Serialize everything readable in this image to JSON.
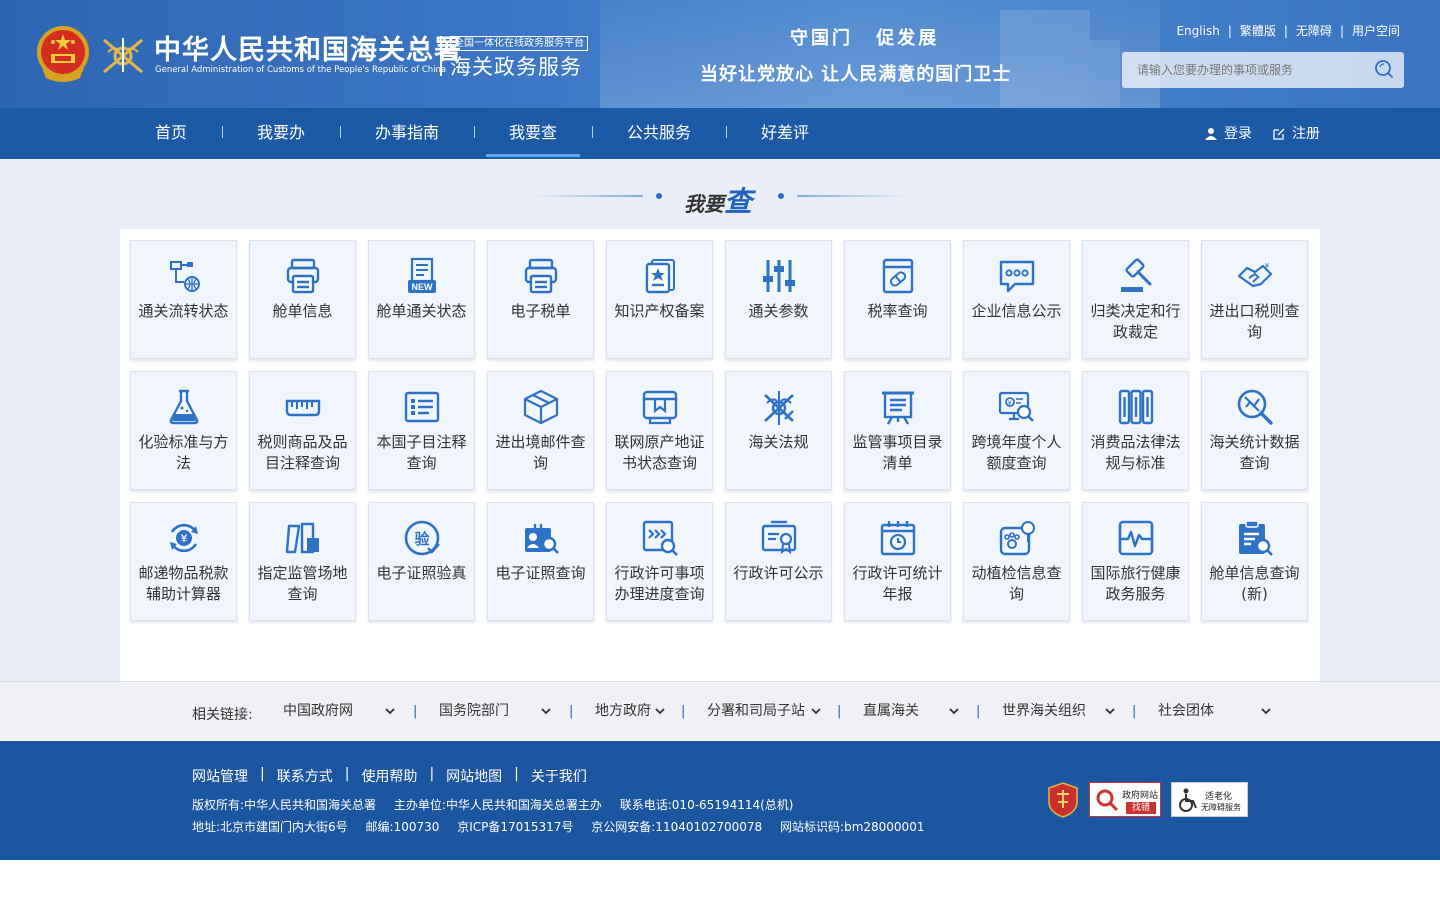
{
  "header": {
    "title_cn": "中华人民共和国海关总署",
    "title_en": "General Administration of Customs of the People's Republic of China",
    "platform_tag": "全国一体化在线政务服务平台",
    "platform_name": "海关政务服务",
    "slogan_line1": "守国门  促发展",
    "slogan_line2": "当好让党放心  让人民满意的国门卫士",
    "top_links": [
      "English",
      "繁體版",
      "无障碍",
      "用户空间"
    ],
    "search_placeholder": "请输入您要办理的事项或服务"
  },
  "nav": {
    "items": [
      "首页",
      "我要办",
      "办事指南",
      "我要查",
      "公共服务",
      "好差评"
    ],
    "active_index": 3,
    "login": "登录",
    "register": "注册"
  },
  "section": {
    "title_prefix": "我要",
    "title_main": "查"
  },
  "services": [
    {
      "label": "通关流转状态",
      "icon": "flow-network-icon"
    },
    {
      "label": "舱单信息",
      "icon": "printer-icon"
    },
    {
      "label": "舱单通关状态",
      "icon": "new-document-icon"
    },
    {
      "label": "电子税单",
      "icon": "printer-icon"
    },
    {
      "label": "知识产权备案",
      "icon": "star-certificate-icon"
    },
    {
      "label": "通关参数",
      "icon": "sliders-icon"
    },
    {
      "label": "税率查询",
      "icon": "rate-document-icon"
    },
    {
      "label": "企业信息公示",
      "icon": "chat-bubble-icon"
    },
    {
      "label": "归类决定和行政裁定",
      "icon": "gavel-icon"
    },
    {
      "label": "进出口税则查询",
      "icon": "handshake-icon"
    },
    {
      "label": "化验标准与方法",
      "icon": "flask-icon"
    },
    {
      "label": "税则商品及品目注释查询",
      "icon": "ruler-icon"
    },
    {
      "label": "本国子目注释查询",
      "icon": "list-icon"
    },
    {
      "label": "进出境邮件查询",
      "icon": "box-icon"
    },
    {
      "label": "联网原产地证书状态查询",
      "icon": "certificate-box-icon"
    },
    {
      "label": "海关法规",
      "icon": "customs-emblem-icon"
    },
    {
      "label": "监管事项目录清单",
      "icon": "easel-list-icon"
    },
    {
      "label": "跨境年度个人额度查询",
      "icon": "monitor-search-icon"
    },
    {
      "label": "消费品法律法规与标准",
      "icon": "books-icon"
    },
    {
      "label": "海关统计数据查询",
      "icon": "search-stats-icon"
    },
    {
      "label": "邮递物品税款辅助计算器",
      "icon": "yen-cycle-icon"
    },
    {
      "label": "指定监管场地查询",
      "icon": "site-blocks-icon"
    },
    {
      "label": "电子证照验真",
      "icon": "verify-icon"
    },
    {
      "label": "电子证照查询",
      "icon": "id-search-icon"
    },
    {
      "label": "行政许可事项办理进度查询",
      "icon": "progress-search-icon"
    },
    {
      "label": "行政许可公示",
      "icon": "license-icon"
    },
    {
      "label": "行政许可统计年报",
      "icon": "calendar-clock-icon"
    },
    {
      "label": "动植检信息查询",
      "icon": "animal-plant-icon"
    },
    {
      "label": "国际旅行健康政务服务",
      "icon": "health-pulse-icon"
    },
    {
      "label": "舱单信息查询(新)",
      "icon": "clipboard-search-icon"
    }
  ],
  "related_links": {
    "label": "相关链接:",
    "selects": [
      "中国政府网",
      "国务院部门",
      "地方政府",
      "分署和司局子站",
      "直属海关",
      "世界海关组织",
      "社会团体"
    ]
  },
  "footer": {
    "links": [
      "网站管理",
      "联系方式",
      "使用帮助",
      "网站地图",
      "关于我们"
    ],
    "row1": [
      "版权所有:中华人民共和国海关总署",
      "主办单位:中华人民共和国海关总署主办",
      "联系电话:010-65194114(总机)"
    ],
    "row2": [
      "地址:北京市建国门内大街6号",
      "邮编:100730",
      "京ICP备17015317号",
      "京公网安备:11040102700078",
      "网站标识码:bm28000001"
    ],
    "badge_gov": "政府网站",
    "badge_gov_sub": "找错",
    "badge_access": "适老化",
    "badge_access_sub": "无障碍服务"
  },
  "colors": {
    "primary": "#1d5aa5",
    "accent": "#1f63bc",
    "icon": "#2e72c7",
    "tile_bg": "#f1f6fc",
    "main_bg": "#e9eef9"
  }
}
